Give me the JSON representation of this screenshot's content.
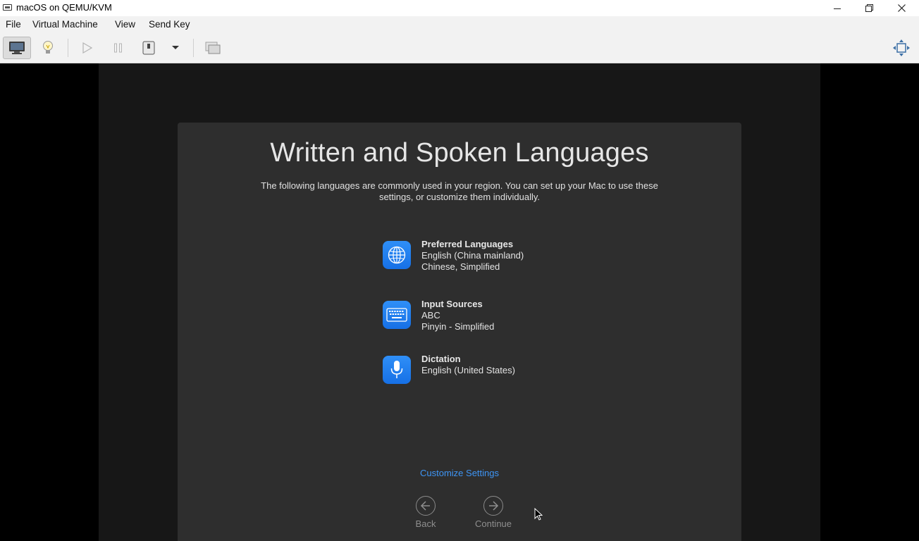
{
  "window": {
    "title": "macOS on QEMU/KVM",
    "controls": [
      "minimize-icon",
      "restore-icon",
      "close-icon"
    ]
  },
  "menubar": {
    "items": [
      "File",
      "Virtual Machine",
      "View",
      "Send Key"
    ]
  },
  "toolbar": {
    "buttons": [
      "console-icon",
      "details-lightbulb-icon",
      "run-icon",
      "pause-icon",
      "shutdown-icon",
      "dropdown-arrow-icon",
      "snapshots-icon",
      "fullscreen-icon"
    ]
  },
  "setup": {
    "title": "Written and Spoken Languages",
    "description": "The following languages are commonly used in your region. You can set up your Mac to use these settings, or customize them individually.",
    "sections": [
      {
        "icon": "globe-icon",
        "heading": "Preferred Languages",
        "lines": [
          "English (China mainland)",
          "Chinese, Simplified"
        ]
      },
      {
        "icon": "keyboard-icon",
        "heading": "Input Sources",
        "lines": [
          "ABC",
          "Pinyin - Simplified"
        ]
      },
      {
        "icon": "microphone-icon",
        "heading": "Dictation",
        "lines": [
          "English (United States)"
        ]
      }
    ],
    "customize_link": "Customize Settings",
    "back_label": "Back",
    "continue_label": "Continue"
  },
  "colors": {
    "accent": "#3e95f5",
    "icon_blue": "#1f7ff0",
    "panel_bg": "#2e2e2e"
  }
}
